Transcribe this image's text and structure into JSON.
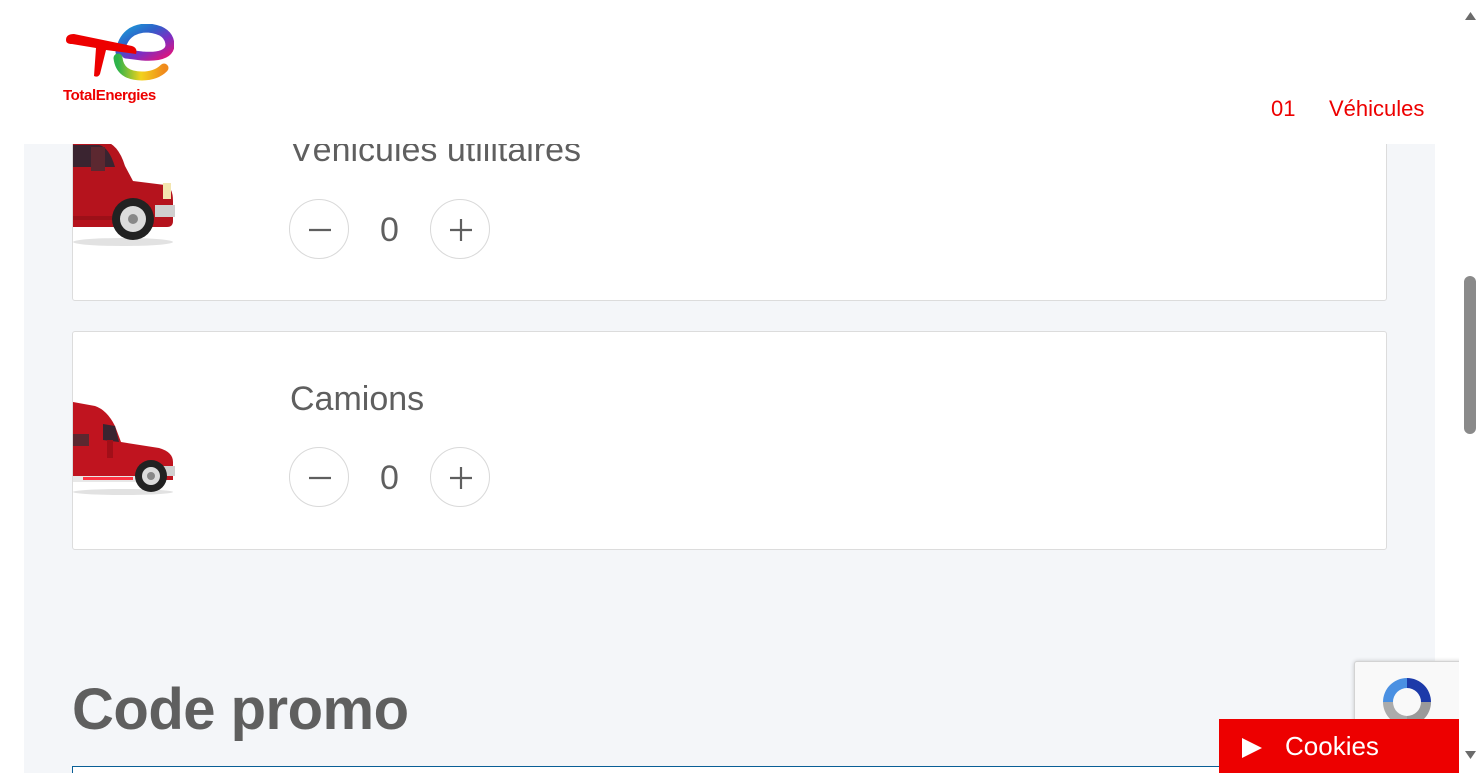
{
  "header": {
    "brand": "TotalEnergies",
    "step_number": "01",
    "step_label": "Véhicules"
  },
  "vehicles": [
    {
      "label": "Véhicules utilitaires",
      "count": "0",
      "icon": "utility-van-icon",
      "color": "#c0141f"
    },
    {
      "label": "Camions",
      "count": "0",
      "icon": "truck-icon",
      "color": "#c0141f"
    }
  ],
  "stepper": {
    "minus_symbol": "−",
    "plus_symbol": "+"
  },
  "promo": {
    "title": "Code promo",
    "placeholder": ""
  },
  "cookies": {
    "label": "Cookies"
  },
  "colors": {
    "accent": "#ed0000",
    "panel": "#f4f6f9",
    "text": "#5f5f5f",
    "input_border": "#0a5f96"
  },
  "scroll": {
    "position": 0.45
  }
}
